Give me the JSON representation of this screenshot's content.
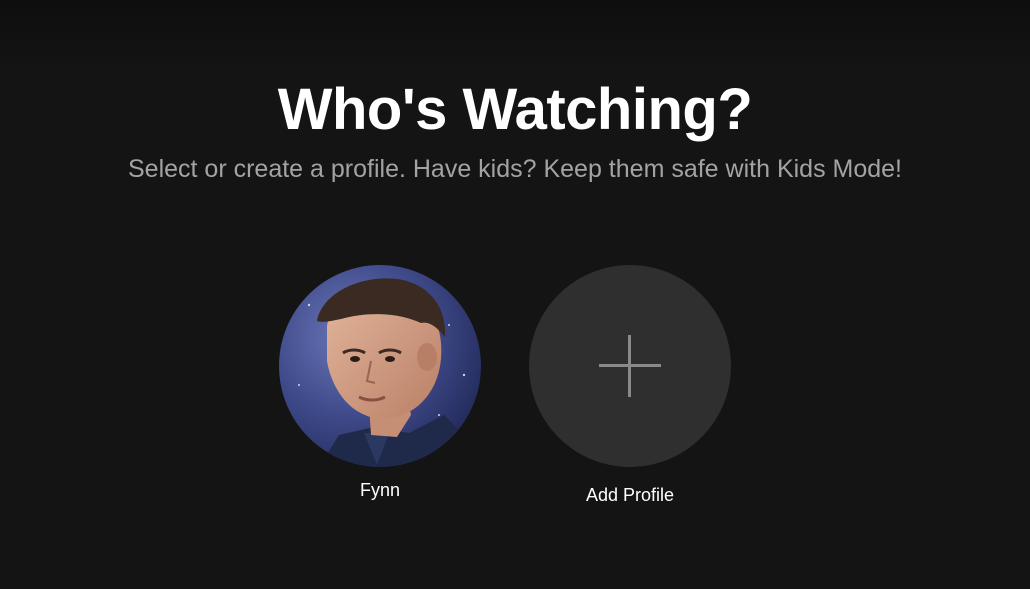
{
  "header": {
    "title": "Who's Watching?",
    "subtitle": "Select or create a profile. Have kids? Keep them safe with Kids Mode!"
  },
  "profiles": [
    {
      "name": "Fynn",
      "avatar_icon": "profile-avatar-photo"
    }
  ],
  "add_profile": {
    "label": "Add Profile",
    "icon": "plus-icon"
  },
  "colors": {
    "background": "#141414",
    "title": "#ffffff",
    "subtitle": "#a3a3a3",
    "add_circle": "#2f2f2f",
    "plus": "#8a8a8a"
  }
}
